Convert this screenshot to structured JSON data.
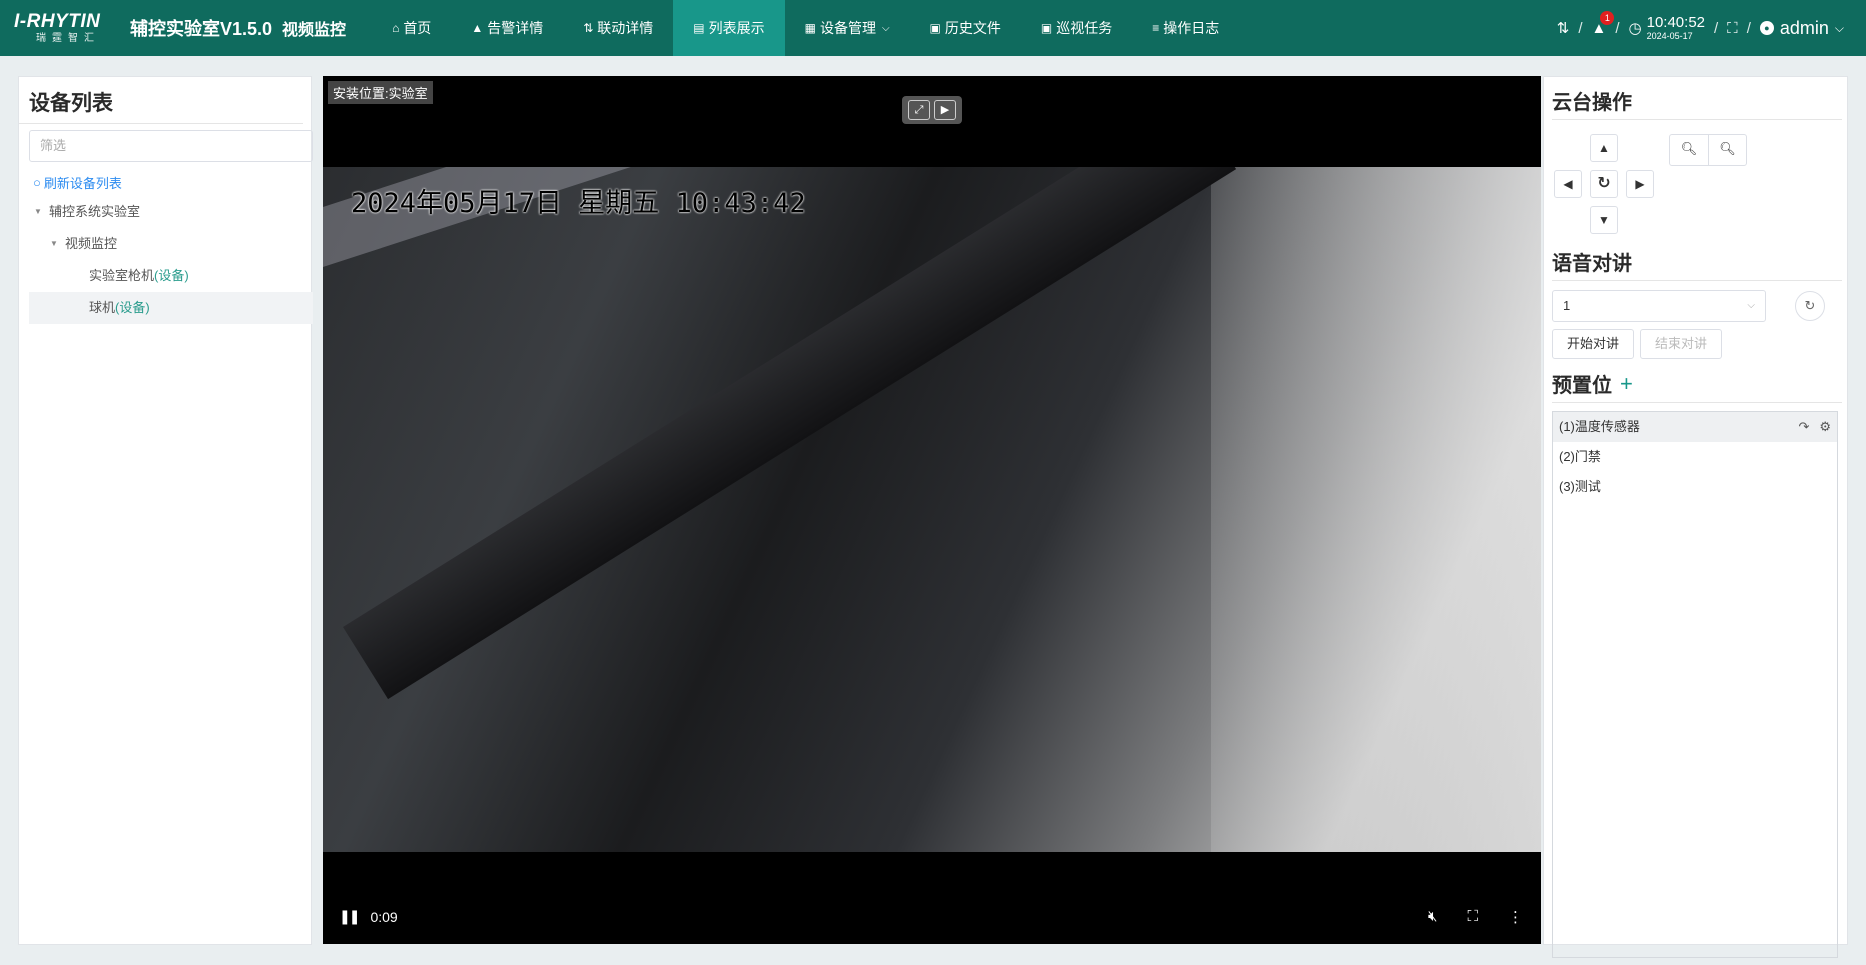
{
  "header": {
    "logo_en": "I-RHYTIN",
    "logo_cn": "瑞霆智汇",
    "title": "辅控实验室V1.5.0",
    "subtitle": "视频监控",
    "accent_color": "#0f6b5e",
    "active_color": "#18978a"
  },
  "nav": [
    {
      "label": "首页",
      "icon": "home-icon"
    },
    {
      "label": "告警详情",
      "icon": "warning-icon"
    },
    {
      "label": "联动详情",
      "icon": "link-icon"
    },
    {
      "label": "列表展示",
      "icon": "list-icon",
      "active": true
    },
    {
      "label": "设备管理",
      "icon": "device-icon",
      "dropdown": true
    },
    {
      "label": "历史文件",
      "icon": "file-icon"
    },
    {
      "label": "巡视任务",
      "icon": "task-icon"
    },
    {
      "label": "操作日志",
      "icon": "log-icon"
    }
  ],
  "status": {
    "alert_count": "1",
    "time": "10:40:52",
    "date": "2024-05-17",
    "user": "admin"
  },
  "left": {
    "title": "设备列表",
    "filter_placeholder": "筛选",
    "refresh": "刷新设备列表",
    "tree": {
      "root": "辅控系统实验室",
      "group": "视频监控",
      "leaf1_name": "实验室枪机",
      "leaf1_tag": "(设备)",
      "leaf2_name": "球机",
      "leaf2_tag": "(设备)"
    }
  },
  "video": {
    "location": "安装位置:实验室",
    "osd": "2024年05月17日 星期五 10:43:42",
    "elapsed": "0:09"
  },
  "right": {
    "ptz_title": "云台操作",
    "voice_title": "语音对讲",
    "voice_channel": "1",
    "start_talk": "开始对讲",
    "end_talk": "结束对讲",
    "preset_title": "预置位",
    "presets": [
      "(1)温度传感器",
      "(2)门禁",
      "(3)测试"
    ]
  }
}
